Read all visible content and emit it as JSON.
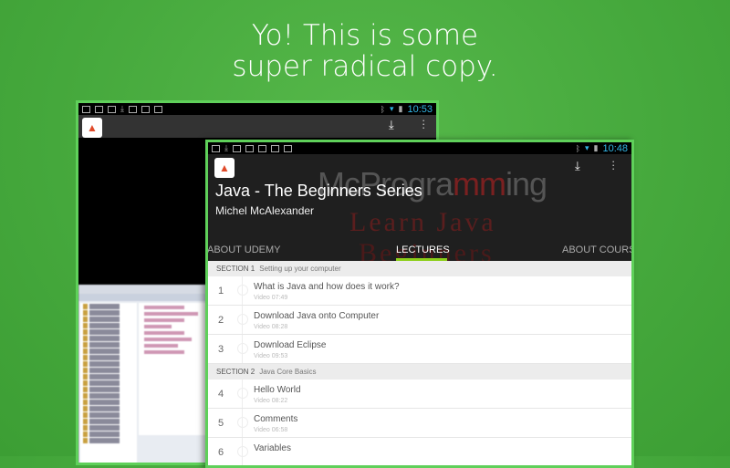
{
  "headline": {
    "line1": "Yo! This is some",
    "line2": "super radical copy."
  },
  "back_device": {
    "time": "10:53",
    "eclipse_title": "Eclipse"
  },
  "front_device": {
    "time": "10:48",
    "logo_text": "udemy",
    "watermark": {
      "brand_a": "McProgra",
      "brand_b": "mm",
      "brand_c": "ing",
      "line2": "Learn Java",
      "line3": "Beginners"
    },
    "course_title": "Java - The Beginners Series",
    "author": "Michel McAlexander",
    "tabs": [
      "ABOUT UDEMY",
      "LECTURES",
      "ABOUT COURSE"
    ],
    "sections": [
      {
        "label": "SECTION 1",
        "title": "Setting up your computer",
        "lectures": [
          {
            "num": "1",
            "title": "What is Java and how does it work?",
            "meta": "Video 07:49"
          },
          {
            "num": "2",
            "title": "Download Java onto Computer",
            "meta": "Video 08:28"
          },
          {
            "num": "3",
            "title": "Download Eclipse",
            "meta": "Video 09:53"
          }
        ]
      },
      {
        "label": "SECTION 2",
        "title": "Java Core Basics",
        "lectures": [
          {
            "num": "4",
            "title": "Hello World",
            "meta": "Video 08:22"
          },
          {
            "num": "5",
            "title": "Comments",
            "meta": "Video 06:58"
          },
          {
            "num": "6",
            "title": "Variables",
            "meta": ""
          }
        ]
      }
    ]
  },
  "colors": {
    "background": "#45a83c",
    "frame": "#5fd05a",
    "tab_indicator": "#8ccf1a",
    "clock": "#33b5e5"
  }
}
